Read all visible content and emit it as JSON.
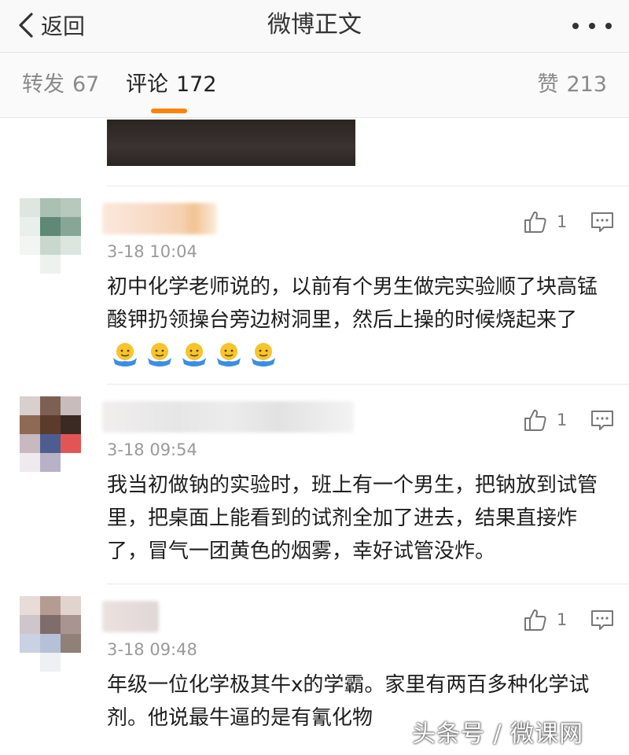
{
  "header": {
    "back_label": "返回",
    "title": "微博正文"
  },
  "tabs": {
    "repost_label": "转发",
    "repost_count": "67",
    "comment_label": "评论",
    "comment_count": "172",
    "likes_label": "赞",
    "likes_count": "213",
    "active": "评论"
  },
  "comments": [
    {
      "time": "3-18 10:04",
      "like_count": "1",
      "text": "初中化学老师说的，以前有个男生做完实验顺了块高锰酸钾扔领操台旁边树洞里，然后上操的时候烧起来了",
      "emoji": [
        "shrug-emoji",
        "shrug-emoji",
        "shrug-emoji",
        "shrug-emoji",
        "shrug-emoji"
      ]
    },
    {
      "time": "3-18 09:54",
      "like_count": "1",
      "text": "我当初做钠的实验时，班上有一个男生，把钠放到试管里，把桌面上能看到的试剂全加了进去，结果直接炸了，冒气一团黄色的烟雾，幸好试管没炸。"
    },
    {
      "time": "3-18 09:48",
      "like_count": "1",
      "text": "年级一位化学极其牛x的学霸。家里有两百多种化学试剂。他说最牛逼的是有氰化物"
    }
  ],
  "watermark": "头条号 / 微课网",
  "colors": {
    "accent": "#ff8200",
    "topbar_bg": "#f9f9f9",
    "muted_text": "#9a9a9a"
  }
}
